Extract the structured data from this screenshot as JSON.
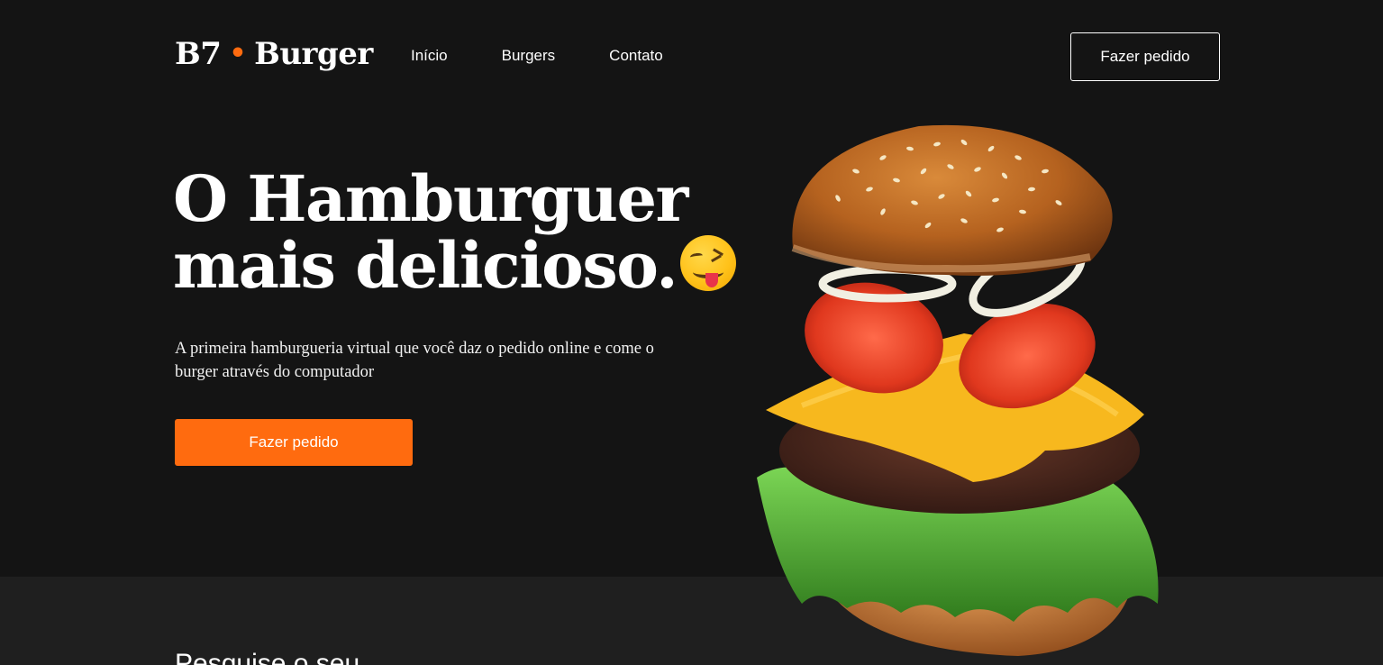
{
  "header": {
    "logo_left": "B7",
    "logo_dot": "•",
    "logo_right": "Burger",
    "nav": [
      "Início",
      "Burgers",
      "Contato"
    ],
    "cta_label": "Fazer pedido"
  },
  "hero": {
    "headline_line1": "O Hamburguer",
    "headline_line2": "mais delicioso.",
    "emoji_icon": "face-savoring-food-icon",
    "subtitle": "A primeira hamburgueria virtual que você daz o pedido online e come o burger através do computador",
    "cta_label": "Fazer pedido",
    "image": "floating-burger-image"
  },
  "section": {
    "title": "Pesquise o seu"
  },
  "colors": {
    "background": "#141414",
    "lower_background": "#1f1f1f",
    "accent": "#ff6b0f",
    "text": "#ffffff"
  }
}
